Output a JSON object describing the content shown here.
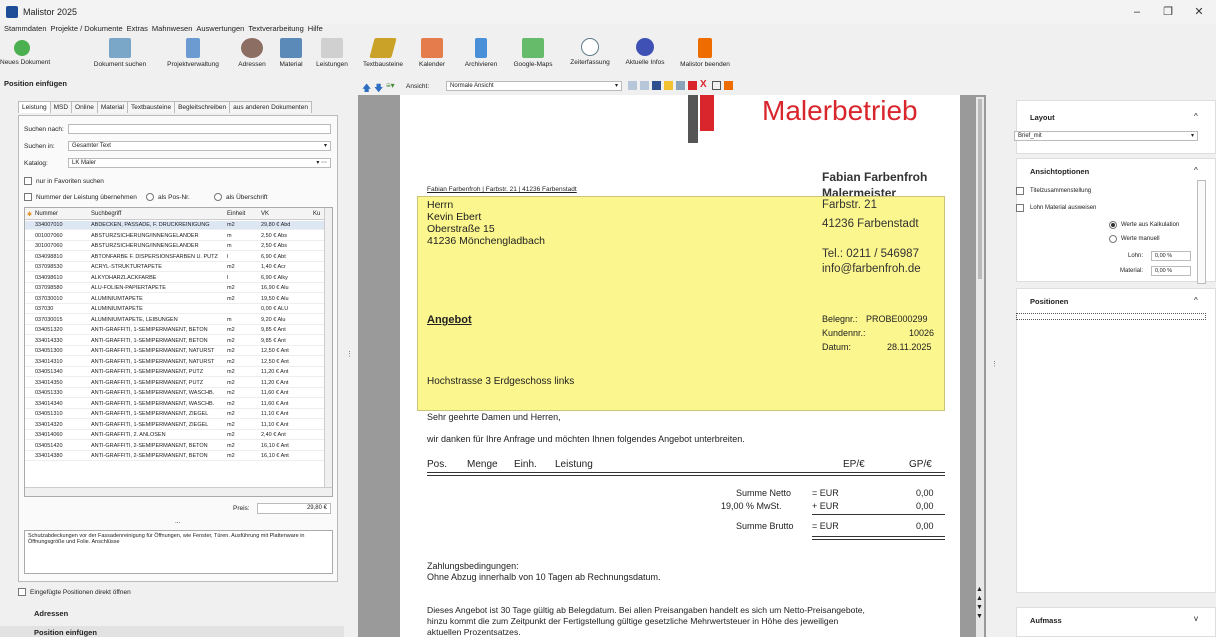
{
  "window": {
    "title": "Malistor 2025",
    "controls": [
      "–",
      "❐",
      "✕"
    ]
  },
  "menu": [
    "Stammdaten",
    "Projekte / Dokumente",
    "Extras",
    "Mahnwesen",
    "Auswertungen",
    "Textverarbeitung",
    "Hilfe"
  ],
  "toolbar": [
    {
      "label": "Neues Dokument",
      "icon": "new-document-icon",
      "color": "#4caf50"
    },
    {
      "label": "Dokument suchen",
      "icon": "search-document-icon",
      "color": "#7aa7c7"
    },
    {
      "label": "Projektverwaltung",
      "icon": "project-icon",
      "color": "#6b9bd1"
    },
    {
      "label": "Adressen",
      "icon": "addresses-icon",
      "color": "#8d6e63"
    },
    {
      "label": "Material",
      "icon": "material-icon",
      "color": "#5c8ab8"
    },
    {
      "label": "Leistungen",
      "icon": "services-icon",
      "color": "#b0b0b0"
    },
    {
      "label": "Textbausteine",
      "icon": "text-blocks-icon",
      "color": "#c9a227"
    },
    {
      "label": "Kalender",
      "icon": "calendar-icon",
      "color": "#e57c4b"
    },
    {
      "label": "Archivieren",
      "icon": "archive-icon",
      "color": "#4a90d9"
    },
    {
      "label": "Google-Maps",
      "icon": "map-icon",
      "color": "#66bb6a"
    },
    {
      "label": "Zeiterfassung",
      "icon": "clock-icon",
      "color": "#90a4ae"
    },
    {
      "label": "Aktuelle Infos",
      "icon": "news-icon",
      "color": "#3f51b5"
    },
    {
      "label": "Malistor beenden",
      "icon": "exit-icon",
      "color": "#ef6c00"
    }
  ],
  "left": {
    "header": "Position einfügen",
    "tabs": [
      "Leistung",
      "MSD",
      "Online",
      "Material",
      "Textbausteine",
      "Begleitschreiben",
      "aus anderen Dokumenten"
    ],
    "search_label": "Suchen nach:",
    "search_value": "",
    "search_in_label": "Suchen in:",
    "search_in_value": "Gesamter Text",
    "catalog_label": "Katalog:",
    "catalog_value": "LK Maler",
    "favorites_label": "nur in Favoriten suchen",
    "number_label": "Nummer der Leistung übernehmen",
    "radio_pos": "als Pos-Nr.",
    "radio_title": "als Überschrift",
    "columns": [
      "Nummer",
      "Suchbegriff",
      "Einheit",
      "VK",
      "Ku"
    ],
    "rows": [
      [
        "334007010",
        "ABDECKEN, PASSADE, F. DRUCKREINIGUNG",
        "m2",
        "29,80 € Abd"
      ],
      [
        "001007060",
        "ABSTURZSICHERUNG/INNENGELÄNDER",
        "m",
        "2,50 € Abs"
      ],
      [
        "301007060",
        "ABSTURZSICHERUNG/INNENGELÄNDER",
        "m",
        "2,50 € Abs"
      ],
      [
        "034098810",
        "ABTÖNFARBE F. DISPERSIONSFARBEN U. PUTZ",
        "l",
        "6,90 € Abt"
      ],
      [
        "037098530",
        "ACRYL-STRUKTURTAPETE",
        "m2",
        "1,40 € Acr"
      ],
      [
        "034098610",
        "ALKYDHARZLACKFARBE",
        "l",
        "6,90 € Alky"
      ],
      [
        "037098580",
        "ALU-FOLIEN-PAPIERTAPETE",
        "m2",
        "16,90 € Alu"
      ],
      [
        "037030010",
        "ALUMINIUMTAPETE",
        "m2",
        "19,50 € Alu"
      ],
      [
        "037030",
        "ALUMINIUMTAPETE",
        "",
        "0,00 € ALU"
      ],
      [
        "037030015",
        "ALUMINIUMTAPETE, LEIBUNGEN",
        "m",
        "9,20 € Alu"
      ],
      [
        "034051320",
        "ANTI-GRAFFITI, 1-SEMIPERMANENT, BETON",
        "m2",
        "9,85 € Ant"
      ],
      [
        "334014330",
        "ANTI-GRAFFITI, 1-SEMIPERMANENT, BETON",
        "m2",
        "9,85 € Ant"
      ],
      [
        "034051300",
        "ANTI-GRAFFITI, 1-SEMIPERMANENT, NATURST",
        "m2",
        "12,50 € Ant"
      ],
      [
        "334014310",
        "ANTI-GRAFFITI, 1-SEMIPERMANENT, NATURST",
        "m2",
        "12,50 € Ant"
      ],
      [
        "034051340",
        "ANTI-GRAFFITI, 1-SEMIPERMANENT, PUTZ",
        "m2",
        "11,20 € Ant"
      ],
      [
        "334014350",
        "ANTI-GRAFFITI, 1-SEMIPERMANENT, PUTZ",
        "m2",
        "11,20 € Ant"
      ],
      [
        "034051330",
        "ANTI-GRAFFITI, 1-SEMIPERMANENT, WASCHB.",
        "m2",
        "11,60 € Ant"
      ],
      [
        "334014340",
        "ANTI-GRAFFITI, 1-SEMIPERMANENT, WASCHB.",
        "m2",
        "11,60 € Ant"
      ],
      [
        "034051310",
        "ANTI-GRAFFITI, 1-SEMIPERMANENT, ZIEGEL",
        "m2",
        "11,10 € Ant"
      ],
      [
        "334014320",
        "ANTI-GRAFFITI, 1-SEMIPERMANENT, ZIEGEL",
        "m2",
        "11,10 € Ant"
      ],
      [
        "334014060",
        "ANTI-GRAFFITI, 2. ANLÖSEN",
        "m2",
        "2,40 € Ant"
      ],
      [
        "034051420",
        "ANTI-GRAFFITI, 2-SEMIPERMANENT, BETON",
        "m2",
        "16,10 € Ant"
      ],
      [
        "334014380",
        "ANTI-GRAFFITI, 2-SEMIPERMANENT, BETON",
        "m2",
        "16,10 € Ant"
      ]
    ],
    "price_label": "Preis:",
    "price_value": "29,80 €",
    "ellipsis": "...",
    "description": "Schutzabdeckungen vor der Fassadenreinigung für Öffnungen, wie Fenster, Türen. Ausführung mit Plattenware in Öffnungsgröße und Folie. Anschlüsse",
    "open_direct_label": "Eingefügte Positionen direkt öffnen",
    "nav_addresses": "Adressen",
    "nav_insert": "Position einfügen"
  },
  "doc_toolbar": {
    "view_label": "Ansicht:",
    "view_value": "Normale Ansicht"
  },
  "doc": {
    "brand": "Malerbetrieb",
    "sender_line": "Fabian Farbenfroh | Farbstr. 21 | 41236 Farbenstadt",
    "recipient": [
      "Herrn",
      "Kevin Ebert",
      "Oberstraße 15",
      "41236  Mönchengladbach"
    ],
    "company_name": "Fabian Farbenfroh",
    "company_title": "Malermeister",
    "company_street": "Farbstr. 21",
    "company_city": "41236 Farbenstadt",
    "company_phone": "Tel.: 0211 / 546987",
    "company_email": "info@farbenfroh.de",
    "doc_type": "Angebot",
    "belegnr_label": "Belegnr.:",
    "belegnr": "PROBE000299",
    "kundennr_label": "Kundennr.:",
    "kundennr": "10026",
    "datum_label": "Datum:",
    "datum": "28.11.2025",
    "project_line": "Hochstrasse 3 Erdgeschoss links",
    "greeting": "Sehr geehrte Damen und Herren,",
    "intro": "wir danken für Ihre Anfrage und möchten Ihnen folgendes Angebot unterbreiten.",
    "table_head": {
      "pos": "Pos.",
      "menge": "Menge",
      "einh": "Einh.",
      "leistung": "Leistung",
      "ep": "EP/€",
      "gp": "GP/€"
    },
    "sum_netto_label": "Summe Netto",
    "sum_netto_cur": "= EUR",
    "sum_netto": "0,00",
    "mwst_label": "19,00 % MwSt.",
    "mwst_cur": "+ EUR",
    "mwst": "0,00",
    "sum_brutto_label": "Summe Brutto",
    "sum_brutto_cur": "= EUR",
    "sum_brutto": "0,00",
    "payment_title": "Zahlungsbedingungen:",
    "payment_text": "Ohne Abzug innerhalb von 10 Tagen ab Rechnungsdatum.",
    "footer_1": "Dieses Angebot ist 30 Tage gültig ab Belegdatum. Bei allen Preisangaben handelt es sich um Netto-Preisangebote,",
    "footer_2": "hinzu kommt die zum Zeitpunkt der Fertigstellung gültige gesetzliche Mehrwertsteuer in Höhe des jeweiligen",
    "footer_3": "aktuellen Prozentsatzes."
  },
  "right": {
    "layout_title": "Layout",
    "layout_value": "Brief_mit",
    "view_options_title": "Ansichtoptionen",
    "opt_title_summary": "Titelzusammenstellung",
    "opt_wage_material": "Lohn Material ausweisen",
    "radio_calc": "Werte aus Kalkulation",
    "radio_manual": "Werte manuell",
    "lohn_label": "Lohn:",
    "lohn_value": "0,00 %",
    "material_label": "Material:",
    "material_value": "0,00 %",
    "positions_title": "Positionen",
    "aufmass_title": "Aufmass"
  },
  "colors": {
    "accent_red": "#d9262c",
    "highlight_yellow": "#fbf68e",
    "selection": "#dde7f3"
  }
}
